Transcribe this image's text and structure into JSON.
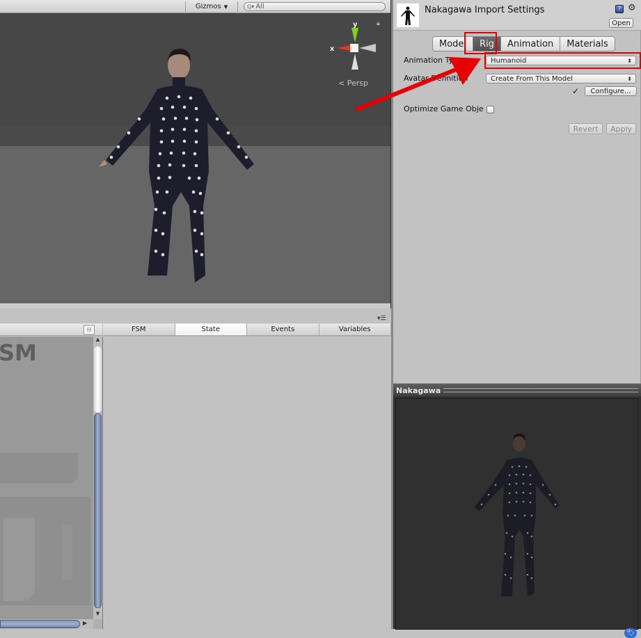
{
  "scene": {
    "gizmos_label": "Gizmos",
    "search_placeholder": "All",
    "axis_x": "x",
    "axis_y": "y",
    "projection_label": "Persp"
  },
  "fsm": {
    "watermark": "SM",
    "tabs": [
      {
        "label": "FSM",
        "active": false
      },
      {
        "label": "State",
        "active": true
      },
      {
        "label": "Events",
        "active": false
      },
      {
        "label": "Variables",
        "active": false
      }
    ]
  },
  "inspector": {
    "title": "Nakagawa Import Settings",
    "open_label": "Open",
    "tabs": [
      {
        "label": "Model",
        "active": false
      },
      {
        "label": "Rig",
        "active": true
      },
      {
        "label": "Animation",
        "active": false
      },
      {
        "label": "Materials",
        "active": false
      }
    ],
    "animation_type_label": "Animation Type",
    "animation_type_value": "Humanoid",
    "avatar_definition_label": "Avatar Definition",
    "avatar_definition_value": "Create From This Model",
    "configured_check": "✓",
    "configure_label": "Configure...",
    "optimize_label": "Optimize Game Obje",
    "optimize_checked": false,
    "revert_label": "Revert",
    "apply_label": "Apply"
  },
  "preview": {
    "title": "Nakagawa"
  },
  "annotations": {
    "highlight_color": "#e60000"
  }
}
